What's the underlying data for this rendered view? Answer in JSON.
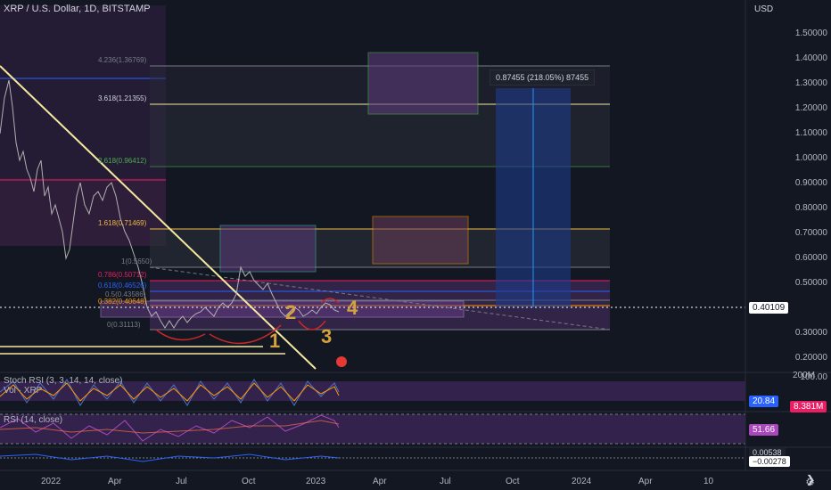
{
  "header": {
    "title": "XRP / U.S. Dollar, 1D, BITSTAMP",
    "currency": "USD"
  },
  "price_axis": [
    "1.50000",
    "1.40000",
    "1.30000",
    "1.20000",
    "1.10000",
    "1.00000",
    "0.90000",
    "0.80000",
    "0.70000",
    "0.60000",
    "0.50000",
    "0.30000",
    "0.20000"
  ],
  "current_price": "0.40109",
  "measure": {
    "text": "0.87455 (218.05%) 87455"
  },
  "fib_labels": {
    "top": "4.236(1.36769)",
    "f3618": "3.618(1.21355)",
    "f2618": "2.618(0.96412)",
    "f1618": "1.618(0.71469)",
    "f1": "1(0.5650)",
    "f0786": "0.786(0.50712)",
    "f0618": "0.618(0.46526)",
    "f05": "0.5(0.43586)",
    "f0382": "0.382(0.40648)",
    "f0": "0(0.31113)"
  },
  "annotations": {
    "a1": "1",
    "a2": "2",
    "a3": "3",
    "a4": "4"
  },
  "stoch_rsi": {
    "title": "Stoch RSI (3, 3, 14, 14, close)",
    "axis_top": "100.00",
    "value": "20.84"
  },
  "volume": {
    "title": "Vol · XRP",
    "axis": "200M",
    "value": "8.381M"
  },
  "rsi": {
    "title": "RSI (14, close)",
    "value": "51.66"
  },
  "macd": {
    "value1": "0.00538",
    "value2": "−0.00278"
  },
  "time_axis": [
    "2022",
    "Apr",
    "Jul",
    "Oct",
    "2023",
    "Apr",
    "Jul",
    "Oct",
    "2024",
    "Apr",
    "10"
  ],
  "colors": {
    "background": "#131722",
    "trendline": "#f5e9a0",
    "annot": "#d4a13c",
    "purple_zone": "#4a2a6e"
  },
  "icons": {
    "settings": "gear-icon",
    "logo": "tv-logo-icon"
  }
}
